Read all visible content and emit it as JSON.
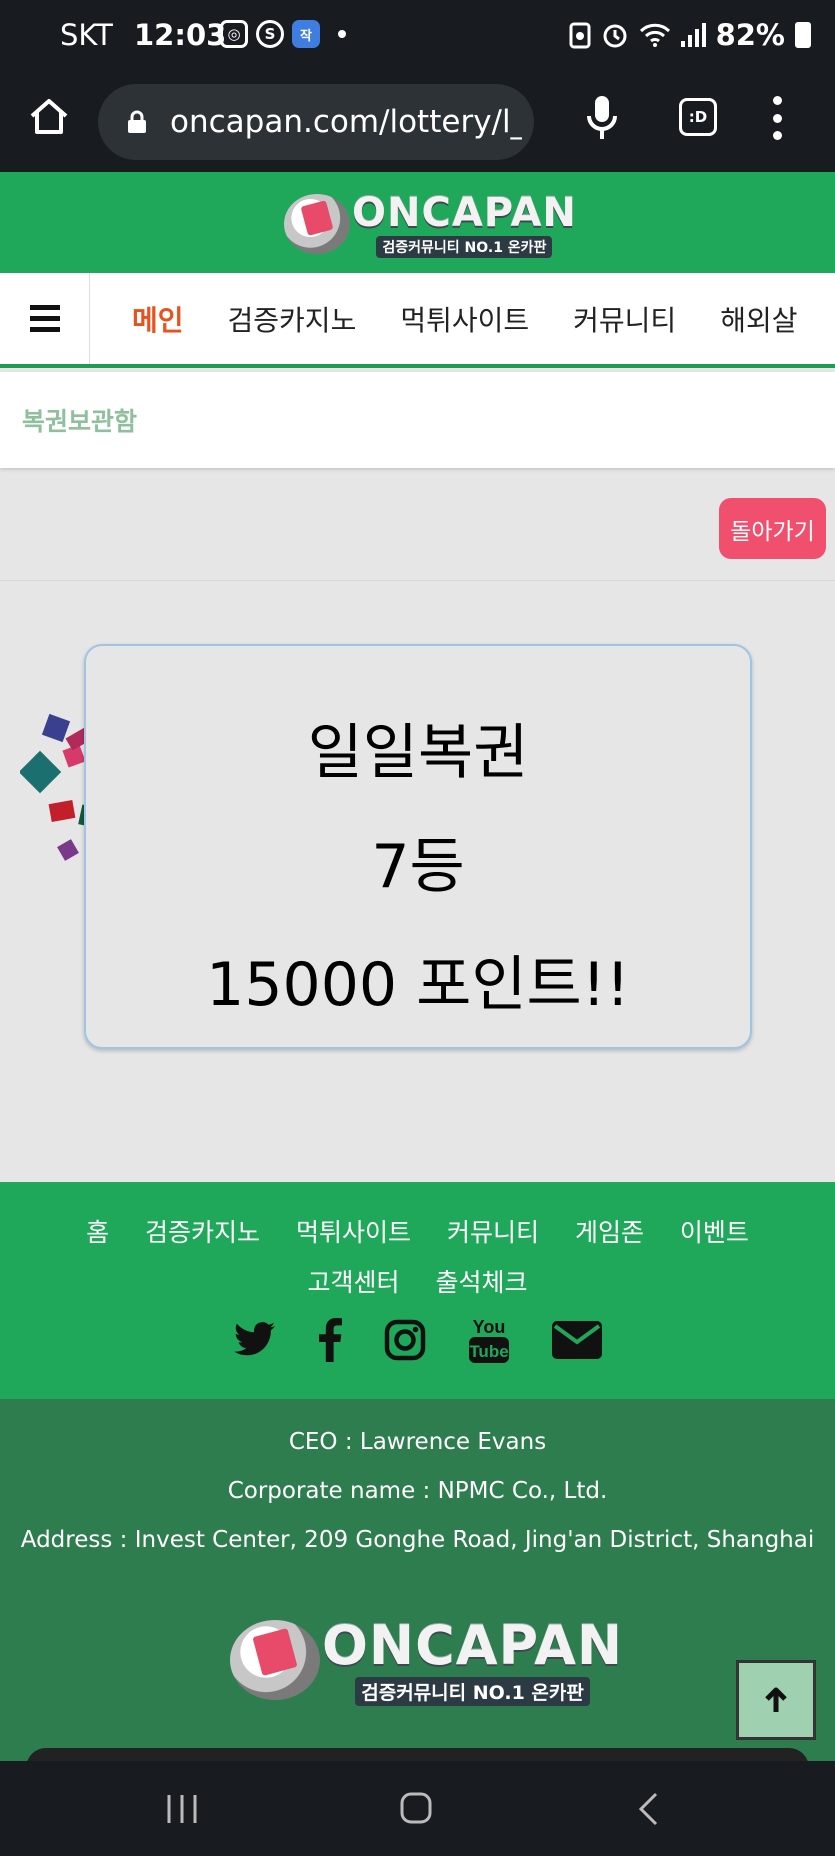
{
  "status_bar": {
    "carrier": "SKT",
    "time": "12:03",
    "battery": "82%",
    "app_badge": "S",
    "news_badge": "작"
  },
  "browser": {
    "url": "oncapan.com/lottery/l_v",
    "tabs_label": ":D"
  },
  "site": {
    "brand": "ONCAPAN",
    "tagline": "검증커뮤니티 NO.1 온카판",
    "nav": [
      "메인",
      "검증카지노",
      "먹튀사이트",
      "커뮤니티",
      "해외살"
    ],
    "breadcrumb": "복권보관함",
    "back_label": "돌아가기"
  },
  "result": {
    "lottery_name": "일일복권",
    "rank": "7등",
    "prize": "15000 포인트!!"
  },
  "footer": {
    "nav_row1": [
      "홈",
      "검증카지노",
      "먹튀사이트",
      "커뮤니티",
      "게임존",
      "이벤트"
    ],
    "nav_row2": [
      "고객센터",
      "출석체크"
    ],
    "social": [
      "twitter-icon",
      "facebook-icon",
      "instagram-icon",
      "youtube-icon",
      "mail-icon"
    ],
    "ceo": "CEO : Lawrence Evans",
    "corp": "Corporate name : NPMC Co., Ltd.",
    "address": "Address : Invest Center, 209 Gonghe Road, Jing'an District, Shanghai",
    "youtube_text_top": "You",
    "youtube_text_bottom": "Tube"
  },
  "colors": {
    "brand_green": "#20a85a",
    "footer_dark_green": "#2e7d4f",
    "active_nav": "#e8521c",
    "back_button": "#f0506e"
  }
}
